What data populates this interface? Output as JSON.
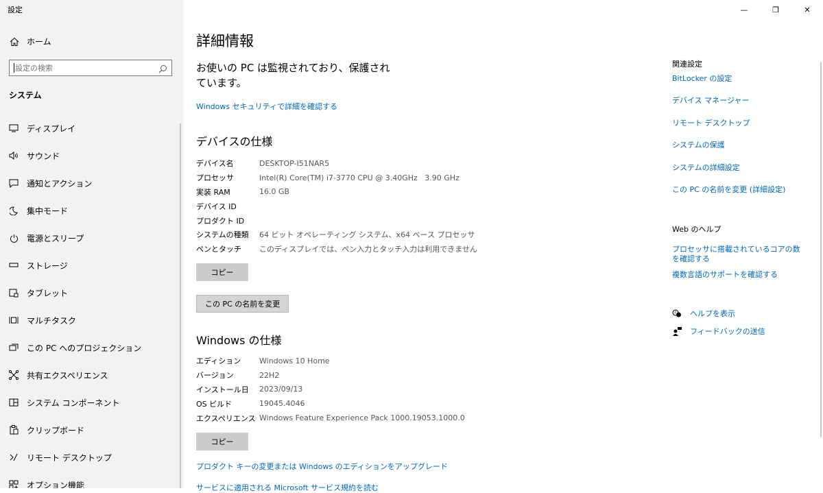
{
  "window": {
    "title": "設定",
    "controls": {
      "minimize": "—",
      "restore": "❐",
      "close": "✕"
    }
  },
  "sidebar": {
    "home": {
      "label": "ホーム",
      "icon": "home-icon"
    },
    "search": {
      "placeholder": "設定の検索",
      "value": ""
    },
    "section": "システム",
    "items": [
      {
        "label": "ディスプレイ",
        "icon": "display-icon"
      },
      {
        "label": "サウンド",
        "icon": "sound-icon"
      },
      {
        "label": "通知とアクション",
        "icon": "notification-icon"
      },
      {
        "label": "集中モード",
        "icon": "moon-icon"
      },
      {
        "label": "電源とスリープ",
        "icon": "power-icon"
      },
      {
        "label": "ストレージ",
        "icon": "storage-icon"
      },
      {
        "label": "タブレット",
        "icon": "tablet-icon"
      },
      {
        "label": "マルチタスク",
        "icon": "multitask-icon"
      },
      {
        "label": "この PC へのプロジェクション",
        "icon": "projection-icon"
      },
      {
        "label": "共有エクスペリエンス",
        "icon": "shared-icon"
      },
      {
        "label": "システム コンポーネント",
        "icon": "components-icon"
      },
      {
        "label": "クリップボード",
        "icon": "clipboard-icon"
      },
      {
        "label": "リモート デスクトップ",
        "icon": "remote-icon"
      },
      {
        "label": "オプション機能",
        "icon": "optional-features-icon"
      }
    ]
  },
  "main": {
    "title": "詳細情報",
    "protection_text": "お使いの PC は監視されており、保護されています。",
    "security_link": "Windows セキュリティで詳細を確認する",
    "device_specs": {
      "heading": "デバイスの仕様",
      "rows": [
        {
          "key": "デバイス名",
          "value": "DESKTOP-I51NAR5"
        },
        {
          "key": "プロセッサ",
          "value": "Intel(R) Core(TM) i7-3770 CPU @ 3.40GHz   3.90 GHz"
        },
        {
          "key": "実装 RAM",
          "value": "16.0 GB"
        },
        {
          "key": "デバイス ID",
          "value": ""
        },
        {
          "key": "プロダクト ID",
          "value": ""
        },
        {
          "key": "システムの種類",
          "value": "64 ビット オペレーティング システム、x64 ベース プロセッサ"
        },
        {
          "key": "ペンとタッチ",
          "value": "このディスプレイでは、ペン入力とタッチ入力は利用できません"
        }
      ],
      "copy_label": "コピー",
      "rename_label": "この PC の名前を変更"
    },
    "windows_specs": {
      "heading": "Windows の仕様",
      "rows": [
        {
          "key": "エディション",
          "value": "Windows 10 Home"
        },
        {
          "key": "バージョン",
          "value": "22H2"
        },
        {
          "key": "インストール日",
          "value": "2023/09/13"
        },
        {
          "key": "OS ビルド",
          "value": "19045.4046"
        },
        {
          "key": "エクスペリエンス",
          "value": "Windows Feature Experience Pack 1000.19053.1000.0"
        }
      ],
      "copy_label": "コピー"
    },
    "upgrade_link": "プロダクト キーの変更または Windows のエディションをアップグレード",
    "clipped_link": "サービスに適用される Microsoft サービス規約を読む"
  },
  "related": {
    "heading": "関連設定",
    "links": [
      "BitLocker の設定",
      "デバイス マネージャー",
      "リモート デスクトップ",
      "システムの保護",
      "システムの詳細設定",
      "この PC の名前を変更 (詳細設定)"
    ],
    "web_help_heading": "Web のヘルプ",
    "web_help_links": [
      "プロセッサに搭載されているコアの数を確認する",
      "複数言語のサポートを確認する"
    ],
    "help": {
      "label": "ヘルプを表示",
      "icon": "help-chat-icon"
    },
    "feedback": {
      "label": "フィードバックの送信",
      "icon": "feedback-icon"
    }
  }
}
